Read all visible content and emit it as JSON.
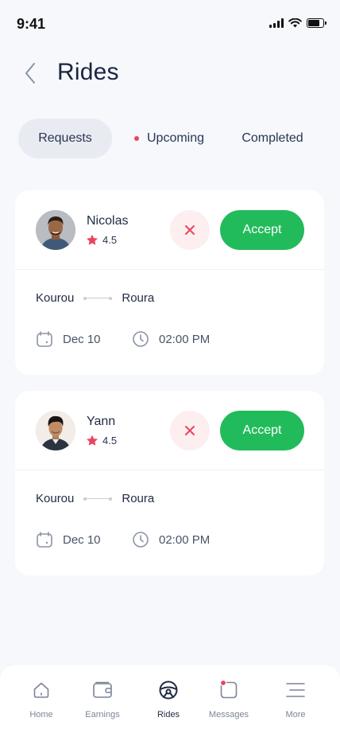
{
  "status_bar": {
    "time": "9:41"
  },
  "header": {
    "title": "Rides"
  },
  "tabs": [
    {
      "label": "Requests",
      "active": true
    },
    {
      "label": "Upcoming",
      "has_dot": true
    },
    {
      "label": "Completed"
    }
  ],
  "rides": [
    {
      "name": "Nicolas",
      "rating": "4.5",
      "decline_icon": "close-icon",
      "accept_label": "Accept",
      "from": "Kourou",
      "to": "Roura",
      "date": "Dec 10",
      "time": "02:00 PM"
    },
    {
      "name": "Yann",
      "rating": "4.5",
      "decline_icon": "close-icon",
      "accept_label": "Accept",
      "from": "Kourou",
      "to": "Roura",
      "date": "Dec 10",
      "time": "02:00 PM"
    }
  ],
  "nav": [
    {
      "label": "Home",
      "icon": "home-icon"
    },
    {
      "label": "Earnings",
      "icon": "wallet-icon"
    },
    {
      "label": "Rides",
      "icon": "steering-wheel-icon",
      "active": true
    },
    {
      "label": "Messages",
      "icon": "message-icon",
      "has_dot": true
    },
    {
      "label": "More",
      "icon": "menu-icon"
    }
  ],
  "colors": {
    "accent": "#22bb5c",
    "decline_bg": "#fdeef0",
    "alert": "#e8455e",
    "background": "#f6f8fc"
  }
}
